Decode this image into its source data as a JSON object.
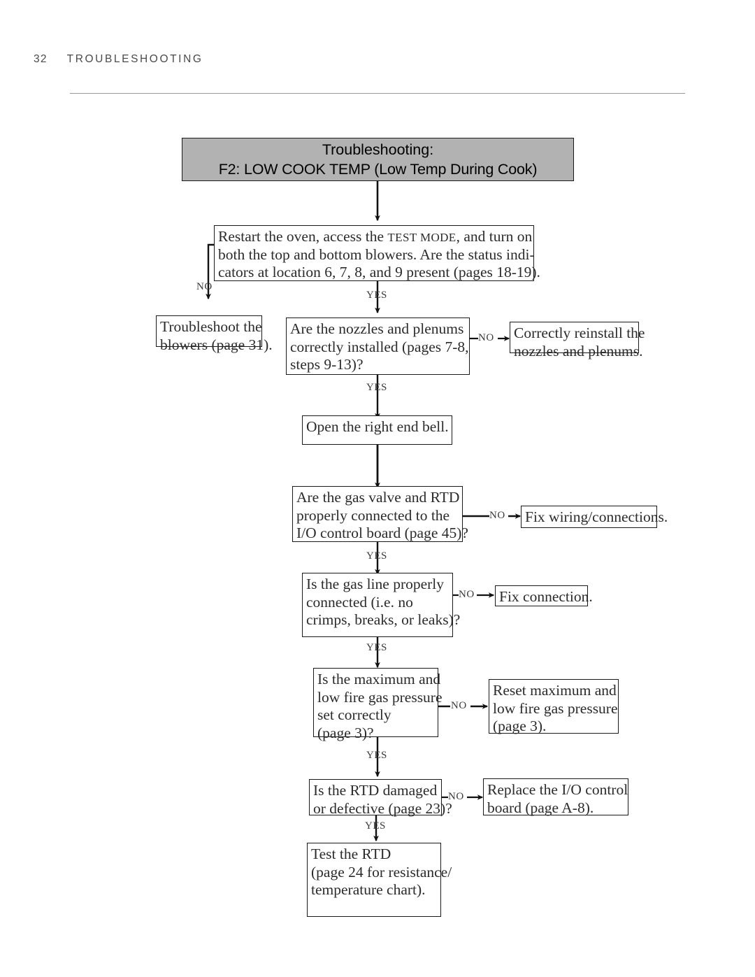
{
  "page": {
    "number": "32",
    "section": "TROUBLESHOOTING"
  },
  "flowchart": {
    "title_line1": "Troubleshooting:",
    "title_line2": "F2: LOW COOK TEMP (Low Temp During Cook)",
    "nodes": {
      "restart": {
        "l1_a": "Restart the oven, access the ",
        "l1_sc": "TEST MODE",
        "l1_b": ", and turn on",
        "l2": "both the top and bottom blowers. Are the status indi-",
        "l3": "cators at location 6, 7, 8, and 9 present (pages 18-19)."
      },
      "blowers": {
        "l1": "Troubleshoot the",
        "l2": "blowers (page 31)."
      },
      "nozzles": {
        "l1": "Are the nozzles and plenums",
        "l2": "correctly installed (pages 7-8,",
        "l3": "steps 9-13)?"
      },
      "reinstall": {
        "l1": "Correctly reinstall the",
        "l2": "nozzles and plenums."
      },
      "endbell": {
        "l1": "Open the right end bell."
      },
      "gasvalve": {
        "l1": "Are the gas valve and RTD",
        "l2": "properly connected to the",
        "l3": "I/O control board (page 45)?"
      },
      "fixwiring": {
        "l1": "Fix wiring/connections."
      },
      "gasline": {
        "l1": "Is the gas line properly",
        "l2": "connected (i.e. no",
        "l3": "crimps, breaks, or leaks)?"
      },
      "fixconnection": {
        "l1": "Fix connection."
      },
      "pressure": {
        "l1": "Is the maximum and",
        "l2": "low fire gas pressure",
        "l3": "set correctly",
        "l4": "(page 3)?"
      },
      "resetpressure": {
        "l1": "Reset maximum and",
        "l2": "low fire gas pressure",
        "l3": "(page 3)."
      },
      "rtd": {
        "l1": "Is the RTD damaged",
        "l2": "or defective (page 23)?"
      },
      "replaceboard": {
        "l1": "Replace the I/O control",
        "l2": "board (page A-8)."
      },
      "testrtd": {
        "l1": "Test the RTD",
        "l2": "(page 24 for resistance/",
        "l3": "temperature chart)."
      }
    },
    "labels": {
      "no_restart": "NO",
      "yes_restart": "YES",
      "no_nozzles": "NO",
      "yes_nozzles": "YES",
      "no_gasvalve": "NO",
      "yes_gasvalve": "YES",
      "no_gasline": "NO",
      "yes_gasline": "YES",
      "no_pressure": "NO",
      "yes_pressure": "YES",
      "no_rtd": "NO",
      "yes_rtd": "YES"
    },
    "colors": {
      "title_fill": "#b2b2b2",
      "line": "#1a1a1a",
      "text": "#2b2b2b",
      "rule": "#9a9a9a"
    }
  }
}
